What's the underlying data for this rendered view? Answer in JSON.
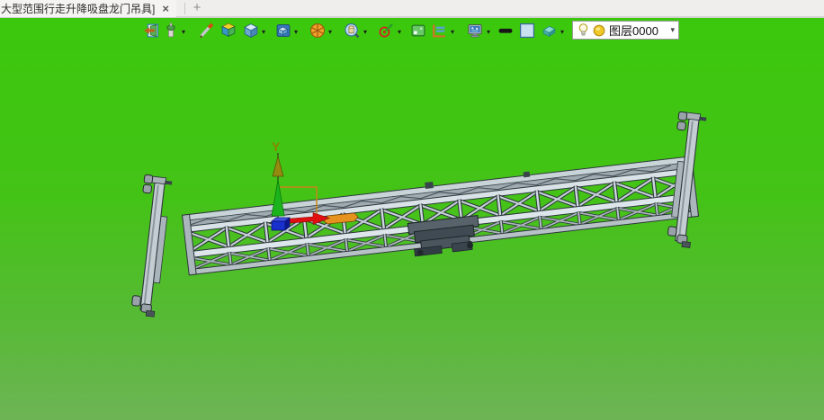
{
  "tabbar": {
    "tab_title": "大型范围行走升降吸盘龙门吊具]",
    "close_glyph": "×",
    "new_tab_glyph": "+"
  },
  "toolbar": {
    "icons": [
      {
        "name": "door-arrow-icon",
        "dropdown": false
      },
      {
        "name": "lamp-icon",
        "dropdown": true
      },
      {
        "name": "brush-icon",
        "dropdown": false
      },
      {
        "name": "box-icon",
        "dropdown": false
      },
      {
        "name": "cube-icon",
        "dropdown": true
      },
      {
        "name": "display-mode-icon",
        "dropdown": true
      },
      {
        "name": "pie-wheel-icon",
        "dropdown": true
      },
      {
        "name": "zoom-sphere-icon",
        "dropdown": true
      },
      {
        "name": "target-axis-icon",
        "dropdown": true
      },
      {
        "name": "viewport-icon",
        "dropdown": false
      },
      {
        "name": "frame-icon",
        "dropdown": true
      },
      {
        "name": "scene-monitor-icon",
        "dropdown": true
      },
      {
        "name": "line-width-icon",
        "dropdown": false
      },
      {
        "name": "color-swatch-icon",
        "dropdown": false
      },
      {
        "name": "eraser-icon",
        "dropdown": true
      }
    ],
    "layer_combo": {
      "value": "图层0000",
      "dropdown_glyph": "▾"
    }
  },
  "viewport": {
    "background_top": "#3bc80c",
    "background_bottom": "#6db455",
    "triad": {
      "y_axis_label": "Y",
      "x_axis_color": "#e01010",
      "y_axis_color": "#1cb41c",
      "marker_color": "#948a10",
      "origin_color": "#1830cc",
      "selection_color": "#e6921e"
    }
  }
}
